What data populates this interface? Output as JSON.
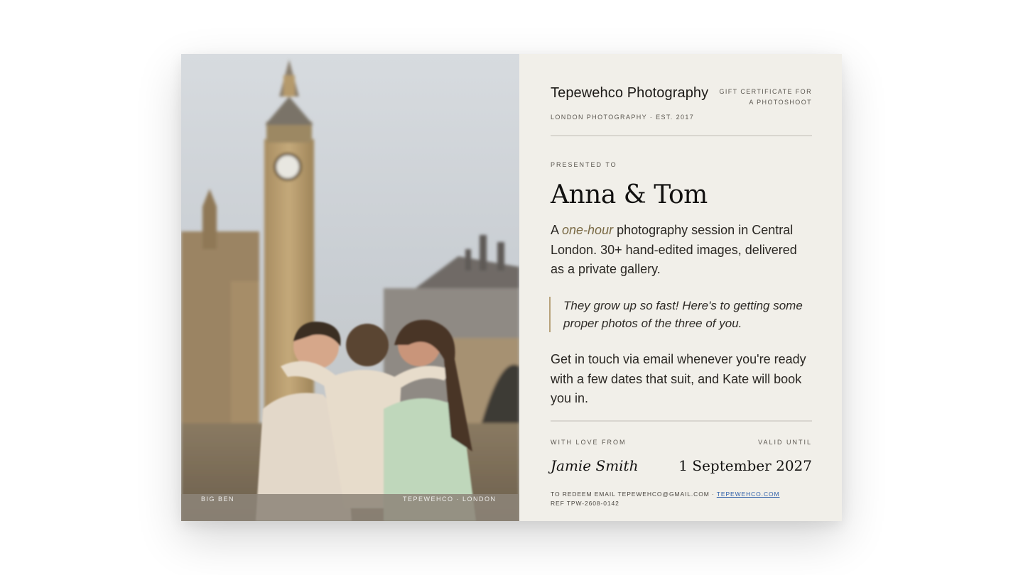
{
  "photo": {
    "caption_left": "BIG BEN",
    "caption_right": "TEPEWEHCO · LONDON"
  },
  "brand": {
    "name": "Tepewehco Photography",
    "subtitle": "LONDON PHOTOGRAPHY · EST. 2017"
  },
  "certificate": {
    "type_line1": "GIFT CERTIFICATE FOR",
    "type_line2": "A PHOTOSHOOT",
    "presented_label": "PRESENTED TO",
    "recipient": "Anna & Tom",
    "desc_prefix": "A ",
    "desc_emphasis": "one-hour",
    "desc_suffix": " photography session in Central London. 30+ hand-edited images, delivered as a private gallery.",
    "quote": "They grow up so fast! Here's to getting some proper photos of the three of you.",
    "contact": "Get in touch via email whenever you're ready with a few dates that suit, and Kate will book you in.",
    "from_label": "WITH LOVE FROM",
    "from_name": "Jamie Smith",
    "valid_label": "VALID UNTIL",
    "valid_date": "1 September 2027",
    "redeem_prefix": "TO REDEEM EMAIL TEPEWEHCO@GMAIL.COM · ",
    "redeem_link": "TEPEWEHCO.COM",
    "reference": "REF TPW-2608-0142"
  },
  "colors": {
    "panel_bg": "#f1efe9",
    "accent_gold": "#b8a27a",
    "link_blue": "#2e5fa8"
  }
}
